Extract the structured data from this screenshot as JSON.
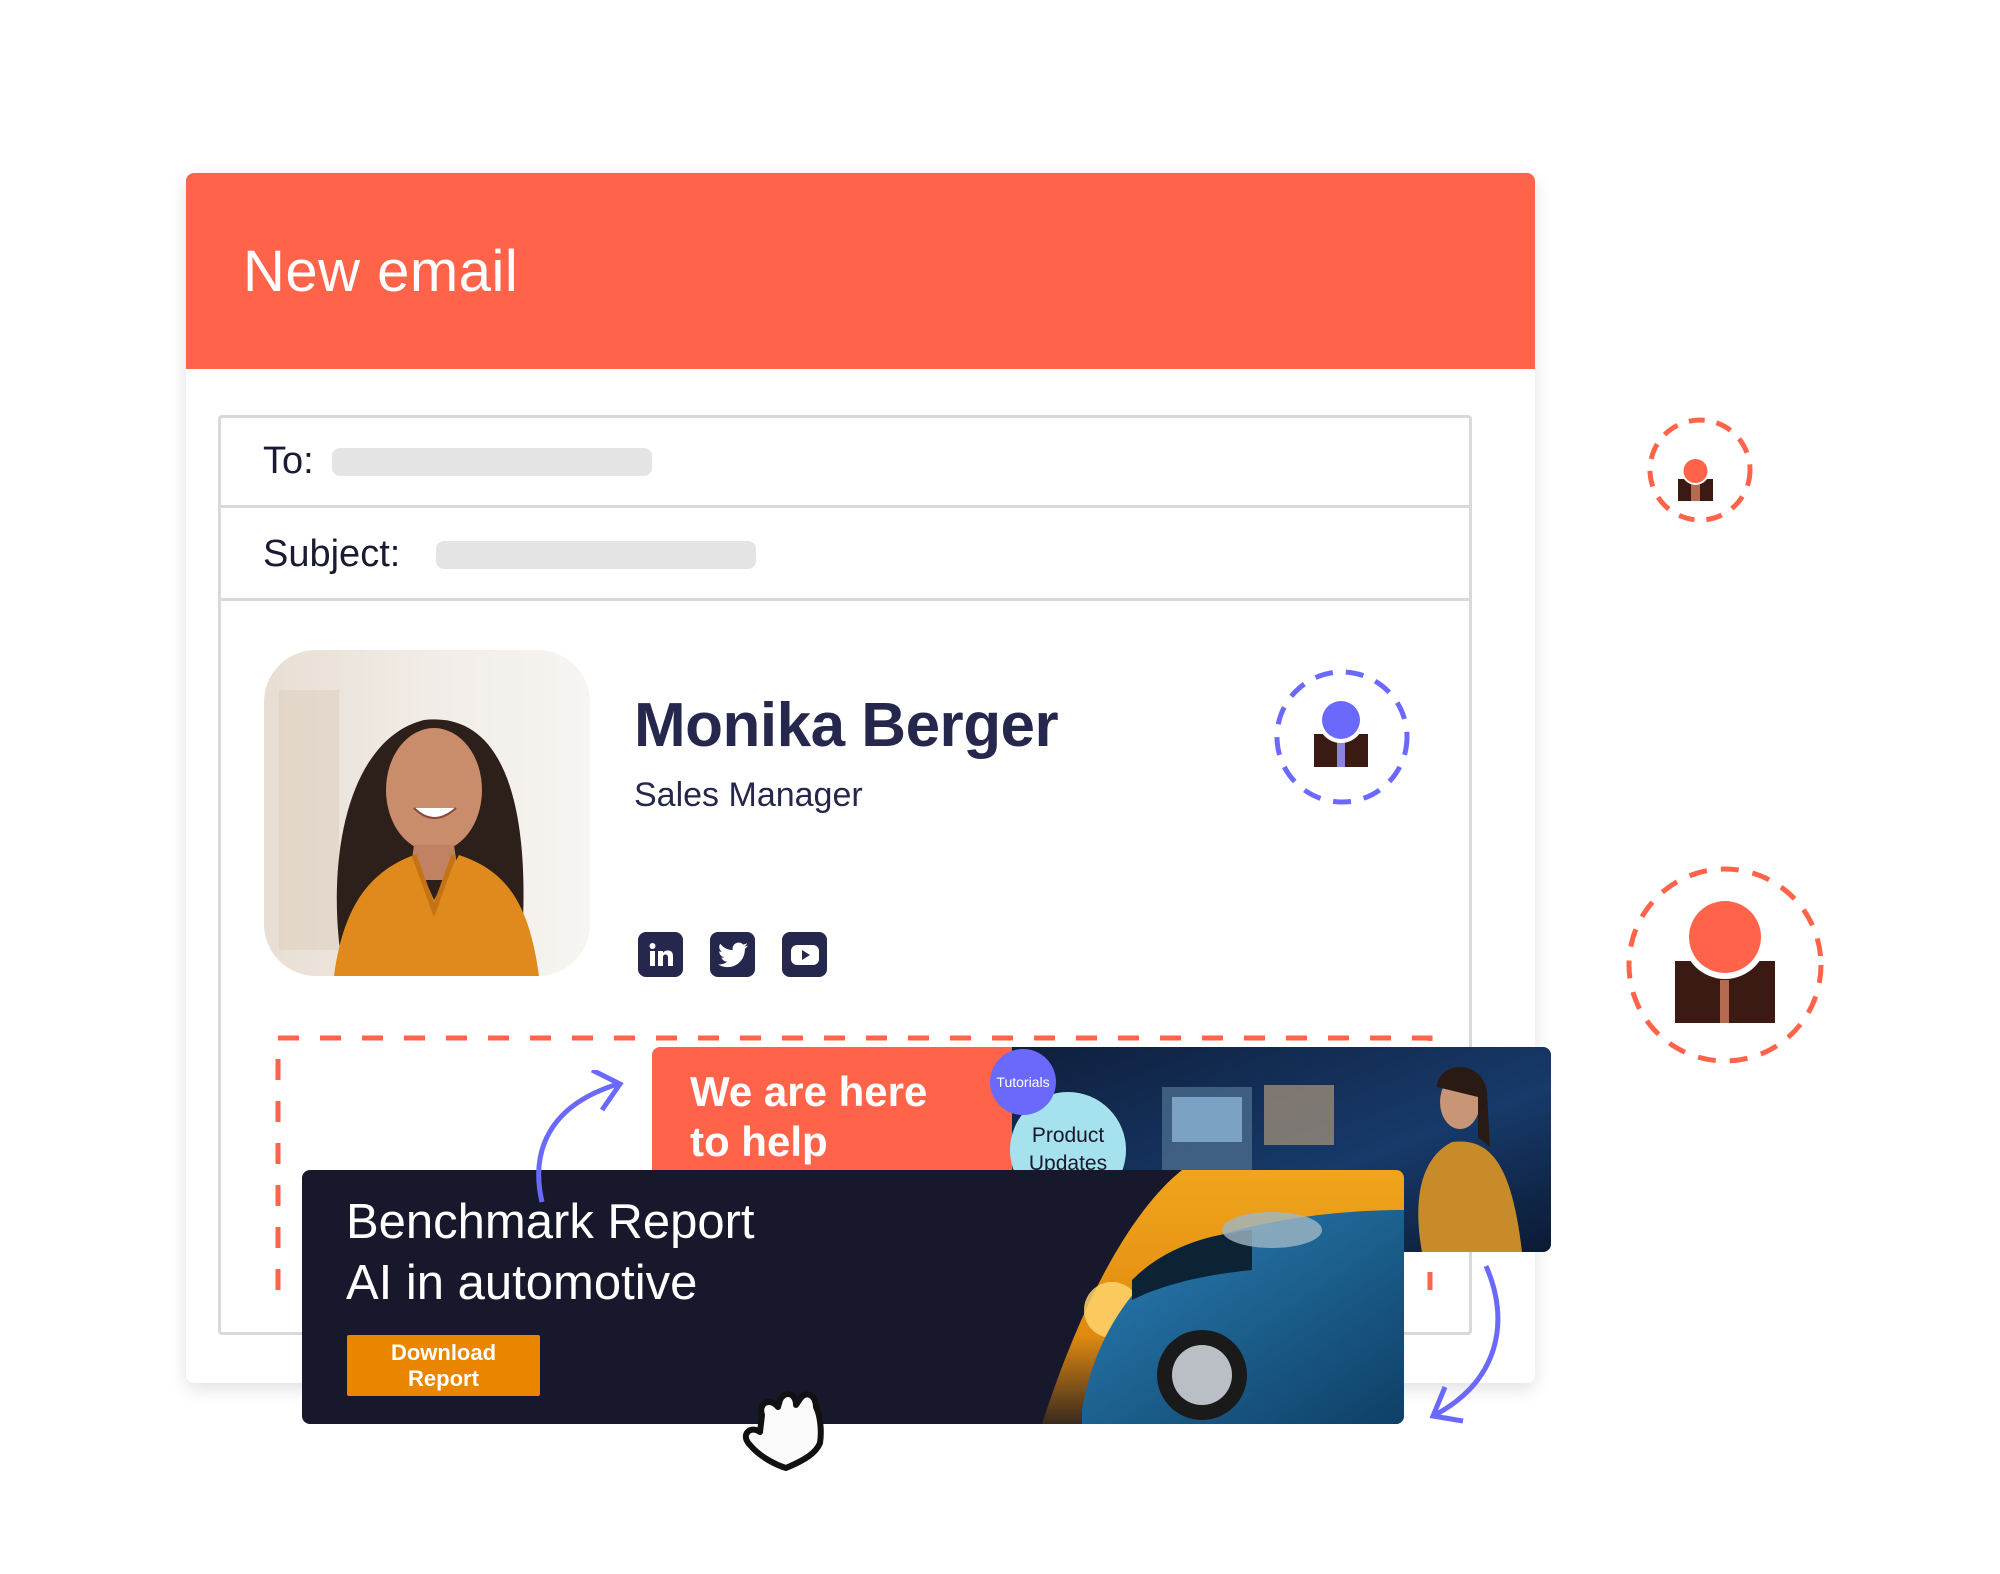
{
  "email": {
    "title": "New email",
    "fields": {
      "to_label": "To:",
      "to_value": "",
      "subject_label": "Subject:",
      "subject_value": ""
    }
  },
  "signature": {
    "name": "Monika Berger",
    "job_title": "Sales Manager",
    "social": [
      {
        "name": "linkedin",
        "glyph": "in"
      },
      {
        "name": "twitter",
        "glyph": "🐦"
      },
      {
        "name": "youtube",
        "glyph": "▶"
      }
    ]
  },
  "banners": {
    "help": {
      "headline_line1": "We are here",
      "headline_line2": "to help",
      "tag_tutorials": "Tutorials",
      "tag_updates_line1": "Product",
      "tag_updates_line2": "Updates"
    },
    "report": {
      "title_line1": "Benchmark Report",
      "title_line2": "AI in automotive",
      "button_label": "Download Report"
    }
  },
  "colors": {
    "brand": "#ff634a",
    "accent": "#6b68fc",
    "navy": "#25274d",
    "banner_dark": "#18182c",
    "button_orange": "#ea8500",
    "placeholder": "#e4e4e4"
  }
}
